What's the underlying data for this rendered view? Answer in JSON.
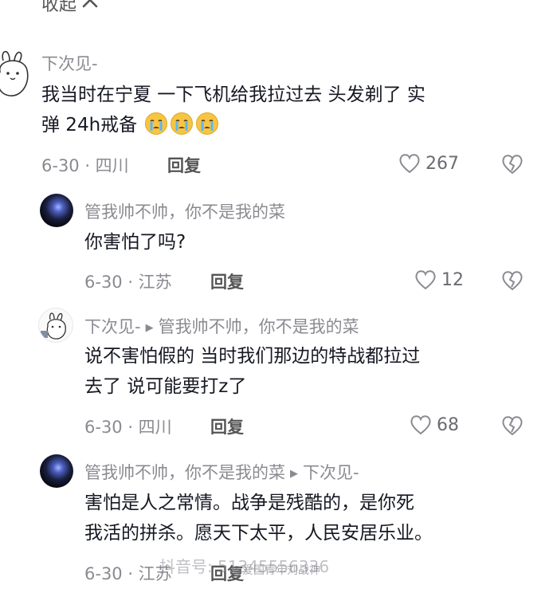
{
  "collapse": {
    "label": "收起"
  },
  "comments": [
    {
      "author": "下次见-",
      "text_line1": "我当时在宁夏 一下飞机给我拉过去 头发剃了 实",
      "text_line2": "弹 24h戒备",
      "date_loc": "6-30 · 四川",
      "reply_label": "回复",
      "likes": "267"
    },
    {
      "author": "管我帅不帅，你不是我的菜",
      "text_line1": "你害怕了吗?",
      "date_loc": "6-30 · 江苏",
      "reply_label": "回复",
      "likes": "12"
    },
    {
      "author": "下次见-",
      "reply_to": "管我帅不帅，你不是我的菜",
      "text_line1": "说不害怕假的 当时我们那边的特战都拉过",
      "text_line2": "去了 说可能要打z了",
      "date_loc": "6-30 · 四川",
      "reply_label": "回复",
      "likes": "68"
    },
    {
      "author": "管我帅不帅，你不是我的菜",
      "reply_to": "下次见-",
      "text_line1": "害怕是人之常情。战争是残酷的，是你死",
      "text_line2": "我活的拼杀。愿天下太平，人民安居乐业。",
      "date_loc": "6-30 · 江苏",
      "reply_label": "回复"
    }
  ],
  "watermark": {
    "line1": "抖音号: 51345556336",
    "line2": "@爱国青年刘战神"
  },
  "colors": {
    "meta": "#8a8b91",
    "text": "#161823",
    "emoji": "#f5c543"
  },
  "icons": [
    "chevron-up-icon",
    "heart-icon",
    "broken-heart-icon",
    "crying-emoji-icon",
    "play-arrow-icon"
  ]
}
